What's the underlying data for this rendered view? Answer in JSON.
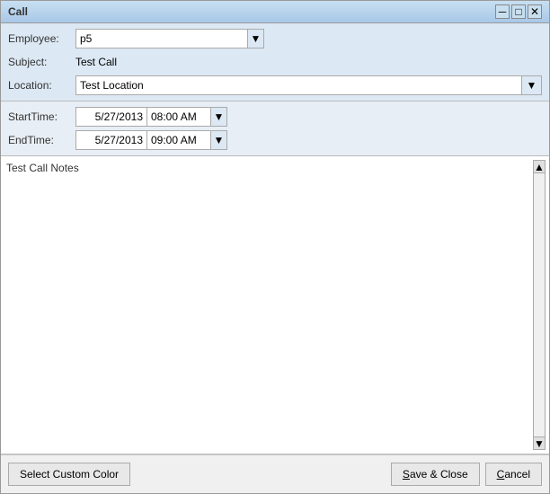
{
  "window": {
    "title": "Call",
    "title_extra": ""
  },
  "form": {
    "employee_label": "Employee:",
    "employee_value": "p5",
    "subject_label": "Subject:",
    "subject_value": "Test Call",
    "location_label": "Location:",
    "location_value": "Test Location"
  },
  "datetime": {
    "start_label": "StartTime:",
    "start_date": "5/27/2013",
    "start_time": "08:00 AM",
    "end_label": "EndTime:",
    "end_date": "5/27/2013",
    "end_time": "09:00 AM"
  },
  "notes": {
    "value": "Test Call Notes"
  },
  "footer": {
    "custom_color_label": "Select Custom Color",
    "save_close_label": "Save & Close",
    "save_close_underline": "S",
    "cancel_label": "Cancel",
    "cancel_underline": "C"
  },
  "icons": {
    "dropdown_arrow": "▼",
    "scroll_up": "▲",
    "scroll_down": "▼",
    "minimize": "─",
    "maximize": "□",
    "close": "✕"
  }
}
